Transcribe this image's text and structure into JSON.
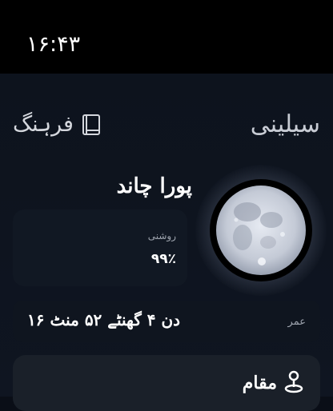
{
  "status": {
    "time": "۱۶:۴۳"
  },
  "header": {
    "title": "سیلینی",
    "glossary_label": "فرہنگ"
  },
  "moon": {
    "phase_name": "پورا چاند",
    "illumination_label": "روشنی",
    "illumination_value": "۹۹٪",
    "age_label": "عمر",
    "age_value": "۱۶ دن ۴ گھنٹے ۵۲ منٹ"
  },
  "location": {
    "label": "مقام"
  }
}
